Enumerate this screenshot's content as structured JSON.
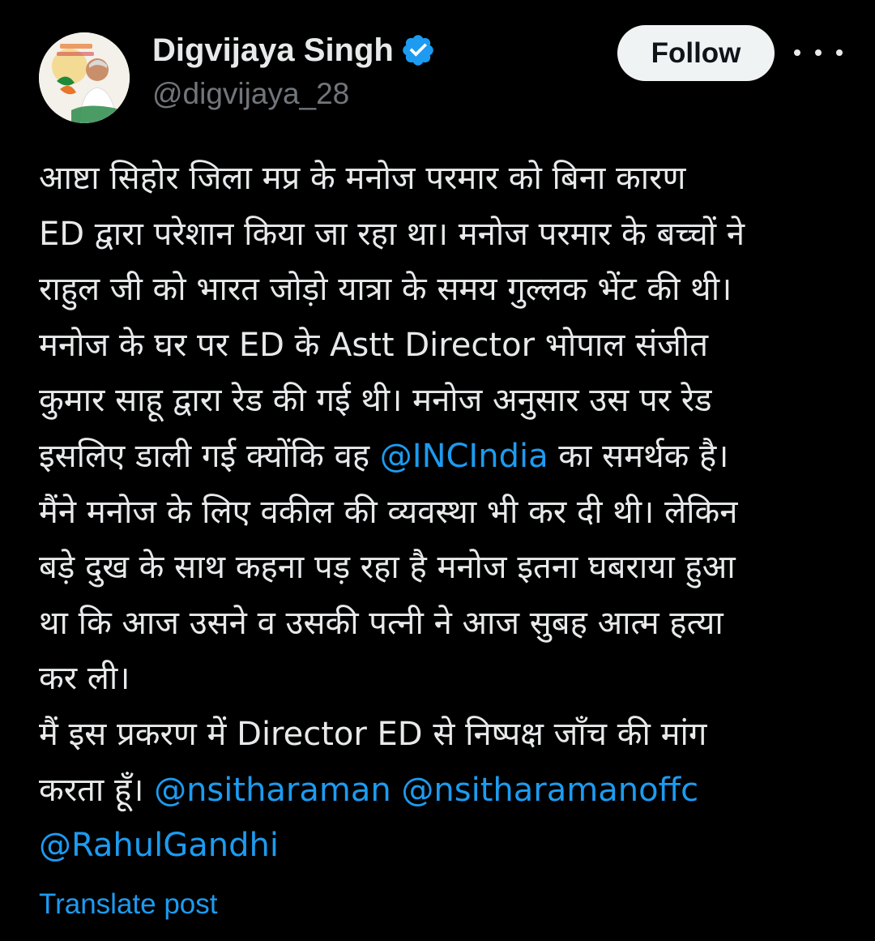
{
  "post": {
    "author": {
      "display_name": "Digvijaya Singh",
      "handle": "@digvijaya_28",
      "verified": true,
      "verified_icon": "verified-badge-icon",
      "avatar_icon": "profile-avatar"
    },
    "follow_label": "Follow",
    "more_icon": "more-options-icon",
    "body_lines": [
      {
        "text": "आष्टा  सिहोर जिला मप्र के मनोज परमार को बिना कारण"
      },
      {
        "text": "ED द्वारा परेशान किया जा रहा था। मनोज परमार के बच्चों ने"
      },
      {
        "text": "राहुल जी को भारत जोड़ो यात्रा के समय गुल्लक भेंट की थी।"
      },
      {
        "text": "मनोज के घर पर  ED के  Astt Director भोपाल संजीत"
      },
      {
        "text": "कुमार साहू द्वारा रेड की गई थी। मनोज अनुसार उस पर रेड"
      },
      {
        "pre": "इसलिए डाली गई क्योंकि वह ",
        "mention": "@INCIndia",
        "post": " का समर्थक है।"
      },
      {
        "text": "मैंने मनोज के लिए वकील की व्यवस्था भी कर दी थी। लेकिन"
      },
      {
        "text": "बड़े दुख के साथ कहना पड़ रहा है मनोज इतना घबराया हुआ"
      },
      {
        "text": "था कि आज उसने व उसकी पत्नी ने आज सुबह आत्म हत्या"
      },
      {
        "text": "कर ली।"
      },
      {
        "text": "मैं इस प्रकरण में Director ED से निष्पक्ष जाँच की मांग"
      },
      {
        "pre": "करता हूँ। ",
        "mention": "@nsitharaman @nsitharamanoffc",
        "post": ""
      },
      {
        "pre": "",
        "mention": "@RahulGandhi",
        "post": ""
      }
    ],
    "translate_label": "Translate post"
  },
  "colors": {
    "background": "#000000",
    "text": "#e7e9ea",
    "secondary_text": "#71767b",
    "accent": "#1d9bf0",
    "follow_bg": "#eff3f4",
    "follow_text": "#0f1419"
  }
}
